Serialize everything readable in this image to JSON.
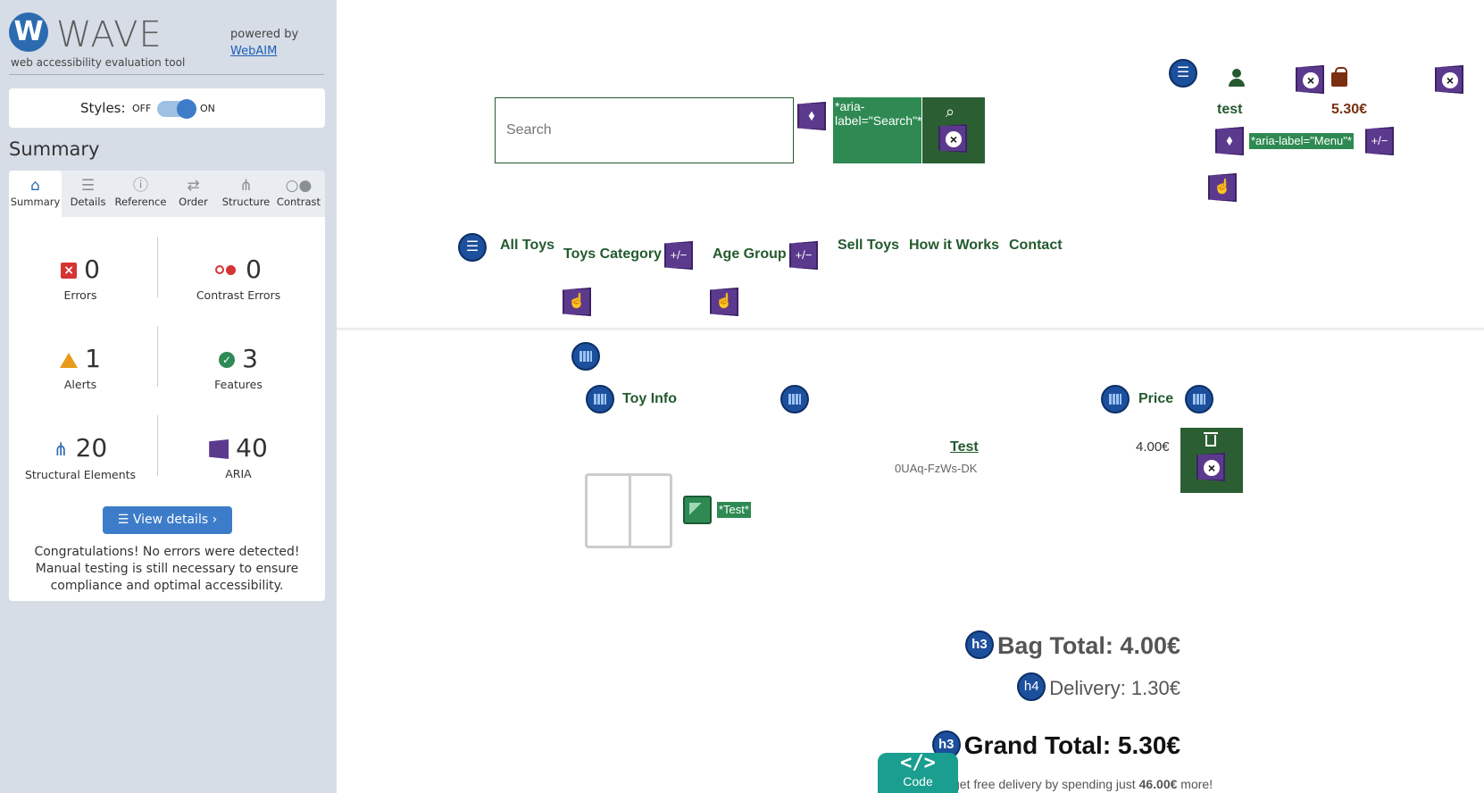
{
  "wave": {
    "logo_letter": "W",
    "logo_text": "WAVE",
    "tagline": "web accessibility evaluation tool",
    "powered_by": "powered by",
    "webaim_link": "WebAIM",
    "styles_label": "Styles:",
    "styles_off": "OFF",
    "styles_on": "ON",
    "styles_enabled": true,
    "summary_heading": "Summary",
    "tabs": [
      {
        "label": "Summary",
        "icon": "home-icon",
        "active": true
      },
      {
        "label": "Details",
        "icon": "list-icon",
        "active": false
      },
      {
        "label": "Reference",
        "icon": "info-icon",
        "active": false
      },
      {
        "label": "Order",
        "icon": "order-icon",
        "active": false
      },
      {
        "label": "Structure",
        "icon": "structure-icon",
        "active": false
      },
      {
        "label": "Contrast",
        "icon": "contrast-icon",
        "active": false
      }
    ],
    "stats": {
      "errors": {
        "count": "0",
        "label": "Errors"
      },
      "contrast_errors": {
        "count": "0",
        "label": "Contrast Errors"
      },
      "alerts": {
        "count": "1",
        "label": "Alerts"
      },
      "features": {
        "count": "3",
        "label": "Features"
      },
      "structural": {
        "count": "20",
        "label": "Structural Elements"
      },
      "aria": {
        "count": "40",
        "label": "ARIA"
      }
    },
    "view_details": "View details ›",
    "congrats": "Congratulations! No errors were detected! Manual testing is still necessary to ensure compliance and optimal accessibility."
  },
  "site": {
    "search_placeholder": "Search",
    "search_aria_tag": "*aria-label=\"Search\"*",
    "menu_aria_tag": "*aria-label=\"Menu\"*",
    "pm_label": "+/−",
    "account_label": "test",
    "bag_amount": "5.30€",
    "nav": {
      "all_toys": "All Toys",
      "toys_category": "Toys Category",
      "age_group": "Age Group",
      "sell_toys": "Sell Toys",
      "how_it_works": "How it Works",
      "contact": "Contact"
    },
    "table": {
      "col_info": "Toy Info",
      "col_price": "Price"
    },
    "item": {
      "name": "Test",
      "sku": "0UAq-FzWs-DK",
      "price": "4.00€",
      "alt_tag": "*Test*"
    },
    "totals": {
      "bag_level": "h3",
      "bag_total": "Bag Total: 4.00€",
      "delivery_level": "h4",
      "delivery": "Delivery: 1.30€",
      "grand_level": "h3",
      "grand_total": "Grand Total: 5.30€",
      "free_prefix": "get free delivery by spending just ",
      "free_amount": "46.00€",
      "free_suffix": " more!"
    },
    "code_button": "Code"
  },
  "colors": {
    "sidebar_bg": "#d7dde6",
    "wave_blue": "#2d6bb1",
    "site_green": "#245a2e",
    "button_green": "#2b5f33",
    "aria_purple": "#5b3a8e",
    "error_red": "#d63333",
    "alert_orange": "#e99a1a",
    "code_teal": "#1a9e8f"
  }
}
